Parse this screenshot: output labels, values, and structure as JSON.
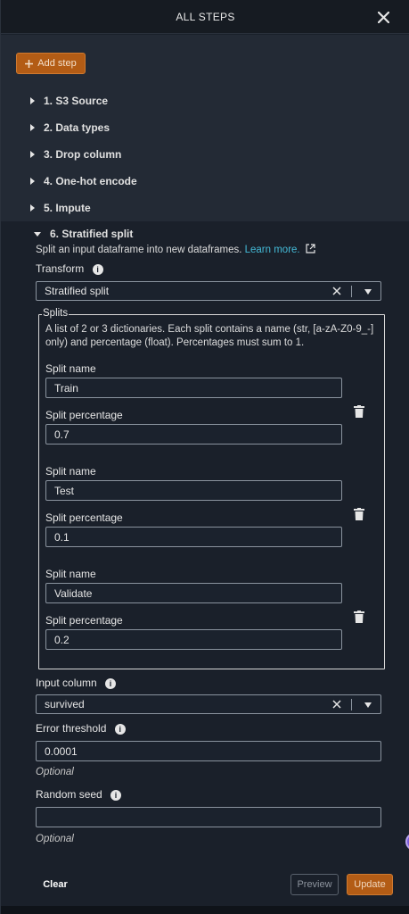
{
  "header": {
    "title": "ALL STEPS"
  },
  "add_step_label": "Add step",
  "steps": [
    {
      "label": "1. S3 Source"
    },
    {
      "label": "2. Data types"
    },
    {
      "label": "3. Drop column"
    },
    {
      "label": "4. One-hot encode"
    },
    {
      "label": "5. Impute"
    }
  ],
  "active_step": {
    "label": "6. Stratified split",
    "description": "Split an input dataframe into new dataframes.",
    "learn_more": "Learn more.",
    "transform": {
      "label": "Transform",
      "value": "Stratified split"
    },
    "splits": {
      "legend": "Splits",
      "description_line1": "A list of 2 or 3 dictionaries. Each split contains a name (str, [a-zA-Z0-9_-]",
      "description_line2": "only) and percentage (float). Percentages must sum to 1.",
      "name_label": "Split name",
      "percentage_label": "Split percentage",
      "items": [
        {
          "name": "Train",
          "percentage": "0.7"
        },
        {
          "name": "Test",
          "percentage": "0.1"
        },
        {
          "name": "Validate",
          "percentage": "0.2"
        }
      ]
    },
    "input_column": {
      "label": "Input column",
      "value": "survived"
    },
    "error_threshold": {
      "label": "Error threshold",
      "value": "0.0001",
      "hint": "Optional"
    },
    "random_seed": {
      "label": "Random seed",
      "value": "",
      "hint": "Optional"
    }
  },
  "footer": {
    "clear_label": "Clear",
    "preview_label": "Preview",
    "update_label": "Update"
  },
  "colors": {
    "accent": "#b35c15",
    "link": "#44b9d6",
    "panel_bg": "#1a202a",
    "steps_bg": "#232a35"
  }
}
